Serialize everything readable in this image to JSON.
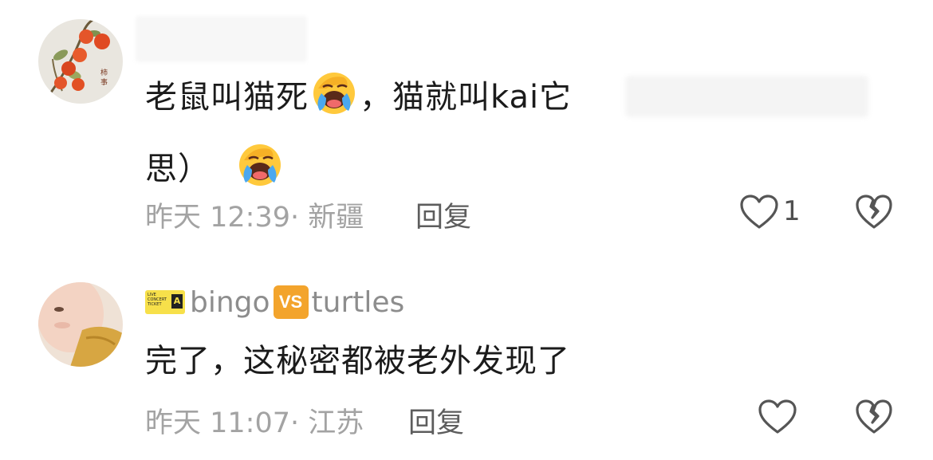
{
  "comments": [
    {
      "text_line1": "老鼠叫猫死",
      "text_line1b": "，猫就叫kai它",
      "text_line2": "思）",
      "emoji_1": "laughing-crying-emoji",
      "emoji_2": "laughing-crying-emoji",
      "time": "昨天 12:39",
      "location": "新疆",
      "reply_label": "回复",
      "like_count": "1"
    },
    {
      "username_part1": "bingo",
      "username_vs": "VS",
      "username_part2": "turtles",
      "badge_text": "LIVE CONCERT TICKET",
      "badge_letter": "A",
      "text": "完了，这秘密都被老外发现了",
      "time": "昨天 11:07",
      "location": "江苏",
      "reply_label": "回复",
      "like_count": ""
    }
  ],
  "colors": {
    "meta_gray": "#a3a3a3",
    "vs_orange": "#f3a42c",
    "badge_yellow": "#f7e04a"
  },
  "icons": [
    "heart-outline-icon",
    "broken-heart-icon"
  ]
}
